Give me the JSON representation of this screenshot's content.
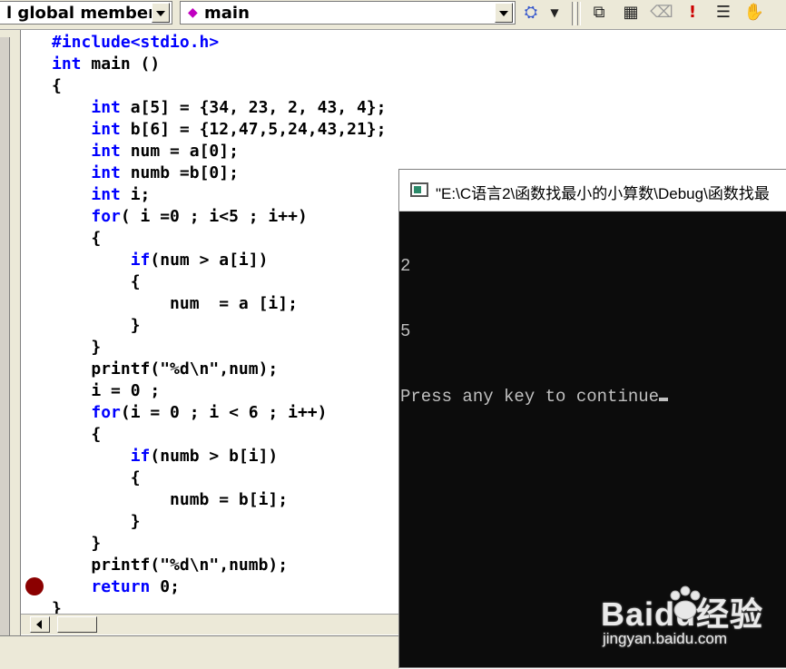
{
  "toolbar": {
    "scope_combo": "l global members",
    "function_combo": "main",
    "icons": [
      "wizard-bar-icon",
      "dropdown-arrow-icon",
      "compile-icon",
      "build-icon",
      "stop-build-icon",
      "execute-icon",
      "breakpoint-toggle-icon",
      "hand-icon"
    ]
  },
  "editor": {
    "lines": [
      [
        {
          "t": "#include<stdio.h>",
          "kw": true
        }
      ],
      [
        {
          "t": "int",
          "kw": true
        },
        {
          "t": " main ()"
        }
      ],
      [
        {
          "t": "{"
        }
      ],
      [
        {
          "t": "    "
        },
        {
          "t": "int",
          "kw": true
        },
        {
          "t": " a[5] = {34, 23, 2, 43, 4};"
        }
      ],
      [
        {
          "t": "    "
        },
        {
          "t": "int",
          "kw": true
        },
        {
          "t": " b[6] = {12,47,5,24,43,21};"
        }
      ],
      [
        {
          "t": "    "
        },
        {
          "t": "int",
          "kw": true
        },
        {
          "t": " num = a[0];"
        }
      ],
      [
        {
          "t": "    "
        },
        {
          "t": "int",
          "kw": true
        },
        {
          "t": " numb =b[0];"
        }
      ],
      [
        {
          "t": "    "
        },
        {
          "t": "int",
          "kw": true
        },
        {
          "t": " i;"
        }
      ],
      [
        {
          "t": "    "
        },
        {
          "t": "for",
          "kw": true
        },
        {
          "t": "( i =0 ; i<5 ; i++)"
        }
      ],
      [
        {
          "t": "    {"
        }
      ],
      [
        {
          "t": "        "
        },
        {
          "t": "if",
          "kw": true
        },
        {
          "t": "(num > a[i])"
        }
      ],
      [
        {
          "t": "        {"
        }
      ],
      [
        {
          "t": "            num  = a [i];"
        }
      ],
      [
        {
          "t": "        }"
        }
      ],
      [
        {
          "t": "    }"
        }
      ],
      [
        {
          "t": "    printf(\"%d\\n\",num);"
        }
      ],
      [
        {
          "t": "    i = 0 ;"
        }
      ],
      [
        {
          "t": "    "
        },
        {
          "t": "for",
          "kw": true
        },
        {
          "t": "(i = 0 ; i < 6 ; i++)"
        }
      ],
      [
        {
          "t": "    {"
        }
      ],
      [
        {
          "t": "        "
        },
        {
          "t": "if",
          "kw": true
        },
        {
          "t": "(numb > b[i])"
        }
      ],
      [
        {
          "t": "        {"
        }
      ],
      [
        {
          "t": "            numb = b[i];"
        }
      ],
      [
        {
          "t": "        }"
        }
      ],
      [
        {
          "t": "    }"
        }
      ],
      [
        {
          "t": "    printf(\"%d\\n\",numb);"
        }
      ],
      [
        {
          "t": "    "
        },
        {
          "t": "return",
          "kw": true
        },
        {
          "t": " 0;"
        }
      ],
      [
        {
          "t": "}"
        }
      ]
    ],
    "keyword_color": "#0000ff",
    "breakpoint_color": "#8b0000"
  },
  "console": {
    "title": "\"E:\\C语言2\\函数找最小的小算数\\Debug\\函数找最",
    "output": [
      "2",
      "5",
      "Press any key to continue"
    ]
  },
  "watermark": {
    "logo": "Baidu经验",
    "url": "jingyan.baidu.com"
  }
}
